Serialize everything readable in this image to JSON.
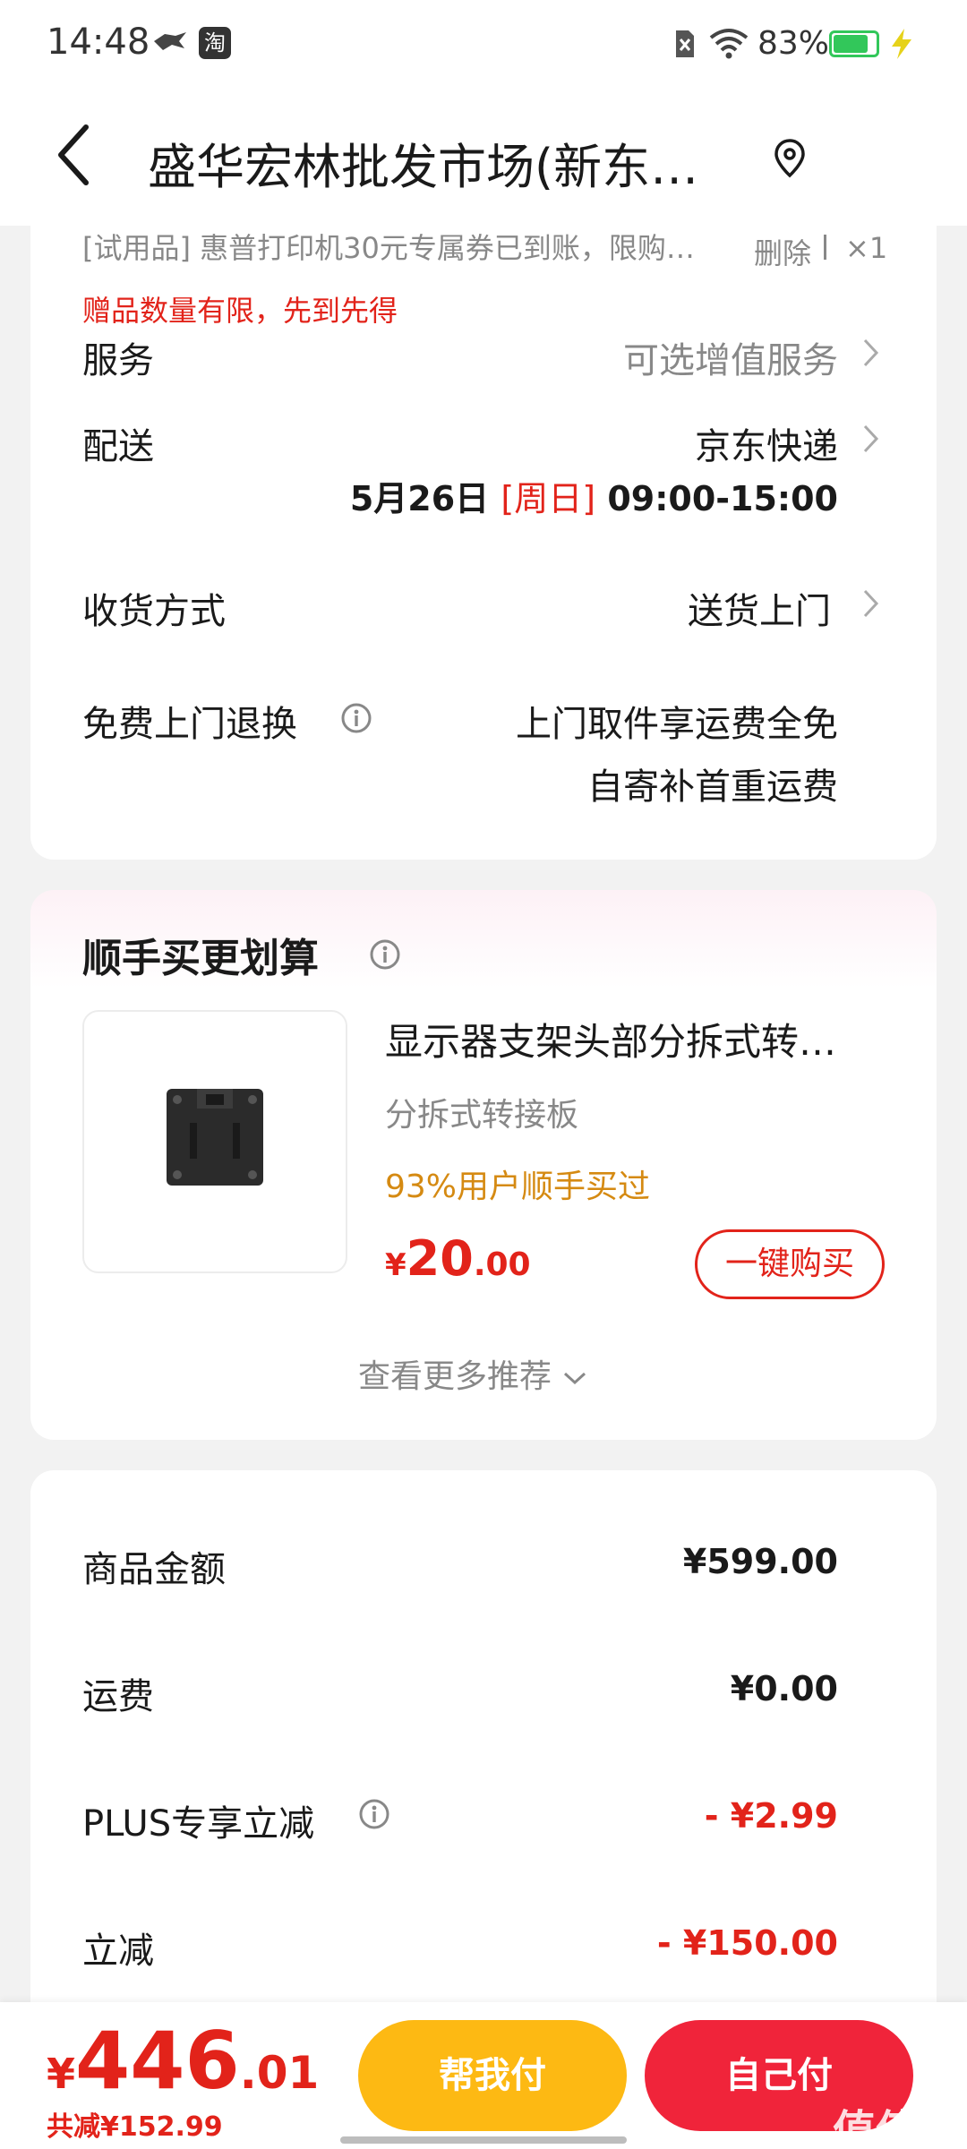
{
  "status_bar": {
    "time": "14:48",
    "taobao_icon_label": "淘",
    "battery": "83%",
    "battery_level": 0.83
  },
  "header": {
    "title": "盛华宏林批发市场(新东…"
  },
  "gift": {
    "text": "[试用品]   惠普打印机30元专属券已到账，限购…",
    "delete_label": "删除",
    "qty": "×1",
    "note": "赠品数量有限，先到先得"
  },
  "service": {
    "label": "服务",
    "value": "可选增值服务"
  },
  "delivery": {
    "label": "配送",
    "carrier": "京东快递",
    "date": "5月26日",
    "weekday": "[周日]",
    "time": "09:00-15:00"
  },
  "receive": {
    "label": "收货方式",
    "value": "送货上门"
  },
  "return_policy": {
    "label": "免费上门退换",
    "line1": "上门取件享运费全免",
    "line2": "自寄补首重运费"
  },
  "upsell": {
    "title": "顺手买更划算",
    "product_name": "显示器支架头部分拆式转…",
    "product_sub": "分拆式转接板",
    "social": "93%用户顺手买过",
    "price_symbol": "¥",
    "price_int": "20",
    "price_dec": ".00",
    "buy_label": "一键购买",
    "more_label": "查看更多推荐"
  },
  "totals": {
    "goods_label": "商品金额",
    "goods_value": "¥599.00",
    "shipping_label": "运费",
    "shipping_value": "¥0.00",
    "plus_label": "PLUS专享立减",
    "plus_value": "- ¥2.99",
    "discount_label": "立减",
    "discount_value": "- ¥150.00"
  },
  "bottom": {
    "symbol": "¥",
    "total_int": "446",
    "total_dec": ".01",
    "saved": "共减¥152.99",
    "help_pay": "帮我付",
    "self_pay": "自己付"
  },
  "watermark": "值值值",
  "colors": {
    "accent_red": "#e2231a",
    "help_pay_yellow": "#fdb913",
    "self_pay_red": "#f0243a",
    "social_orange": "#d58a12"
  },
  "icons": [
    "back-icon",
    "location-icon",
    "info-icon",
    "chevron-right-icon",
    "chevron-down-icon",
    "wifi-icon",
    "battery-icon",
    "charging-icon",
    "sim-off-icon",
    "bird-icon",
    "taobao-icon"
  ]
}
